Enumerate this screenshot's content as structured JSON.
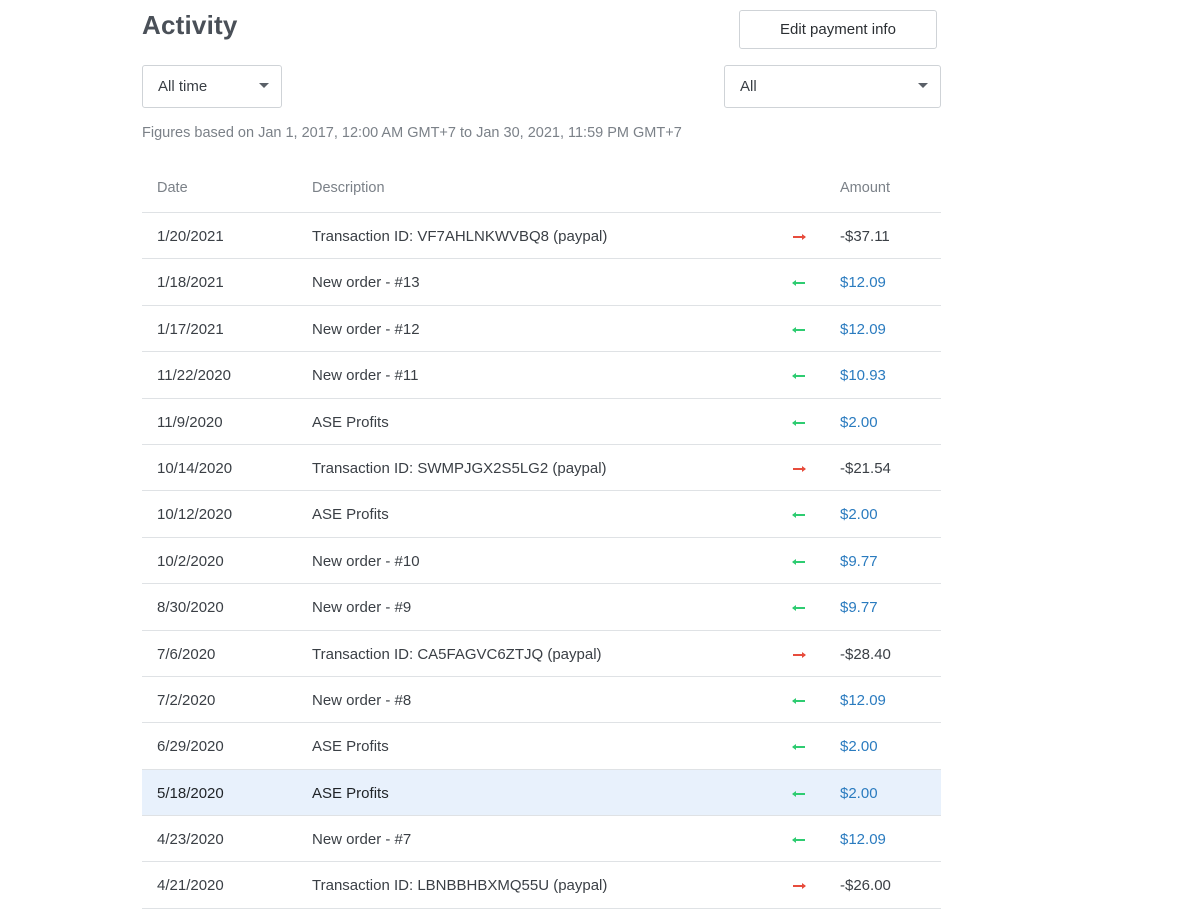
{
  "header": {
    "title": "Activity",
    "edit_payment_label": "Edit payment info"
  },
  "filters": {
    "time_range": "All time",
    "type": "All"
  },
  "figures_note": "Figures based on Jan 1, 2017, 12:00 AM GMT+7 to Jan 30, 2021, 11:59 PM GMT+7",
  "table": {
    "columns": {
      "date": "Date",
      "description": "Description",
      "amount": "Amount"
    },
    "rows": [
      {
        "date": "1/20/2021",
        "description": "Transaction ID: VF7AHLNKWVBQ8 (paypal)",
        "amount": "-$37.11",
        "direction": "out"
      },
      {
        "date": "1/18/2021",
        "description": "New order - #13",
        "amount": "$12.09",
        "direction": "in"
      },
      {
        "date": "1/17/2021",
        "description": "New order - #12",
        "amount": "$12.09",
        "direction": "in"
      },
      {
        "date": "11/22/2020",
        "description": "New order - #11",
        "amount": "$10.93",
        "direction": "in"
      },
      {
        "date": "11/9/2020",
        "description": "ASE Profits",
        "amount": "$2.00",
        "direction": "in"
      },
      {
        "date": "10/14/2020",
        "description": "Transaction ID: SWMPJGX2S5LG2 (paypal)",
        "amount": "-$21.54",
        "direction": "out"
      },
      {
        "date": "10/12/2020",
        "description": "ASE Profits",
        "amount": "$2.00",
        "direction": "in"
      },
      {
        "date": "10/2/2020",
        "description": "New order - #10",
        "amount": "$9.77",
        "direction": "in"
      },
      {
        "date": "8/30/2020",
        "description": "New order - #9",
        "amount": "$9.77",
        "direction": "in"
      },
      {
        "date": "7/6/2020",
        "description": "Transaction ID: CA5FAGVC6ZTJQ (paypal)",
        "amount": "-$28.40",
        "direction": "out"
      },
      {
        "date": "7/2/2020",
        "description": "New order - #8",
        "amount": "$12.09",
        "direction": "in"
      },
      {
        "date": "6/29/2020",
        "description": "ASE Profits",
        "amount": "$2.00",
        "direction": "in"
      },
      {
        "date": "5/18/2020",
        "description": "ASE Profits",
        "amount": "$2.00",
        "direction": "in",
        "highlighted": true
      },
      {
        "date": "4/23/2020",
        "description": "New order - #7",
        "amount": "$12.09",
        "direction": "in"
      },
      {
        "date": "4/21/2020",
        "description": "Transaction ID: LBNBBHBXMQ55U (paypal)",
        "amount": "-$26.00",
        "direction": "out"
      }
    ]
  },
  "colors": {
    "incoming_arrow": "#2ecc71",
    "outgoing_arrow": "#e74c3c",
    "credit_amount": "#2a7bbf",
    "row_highlight": "#e8f1fc"
  },
  "icons": {
    "incoming": "arrow-left-icon",
    "outgoing": "arrow-right-icon",
    "dropdown": "caret-down-icon"
  }
}
